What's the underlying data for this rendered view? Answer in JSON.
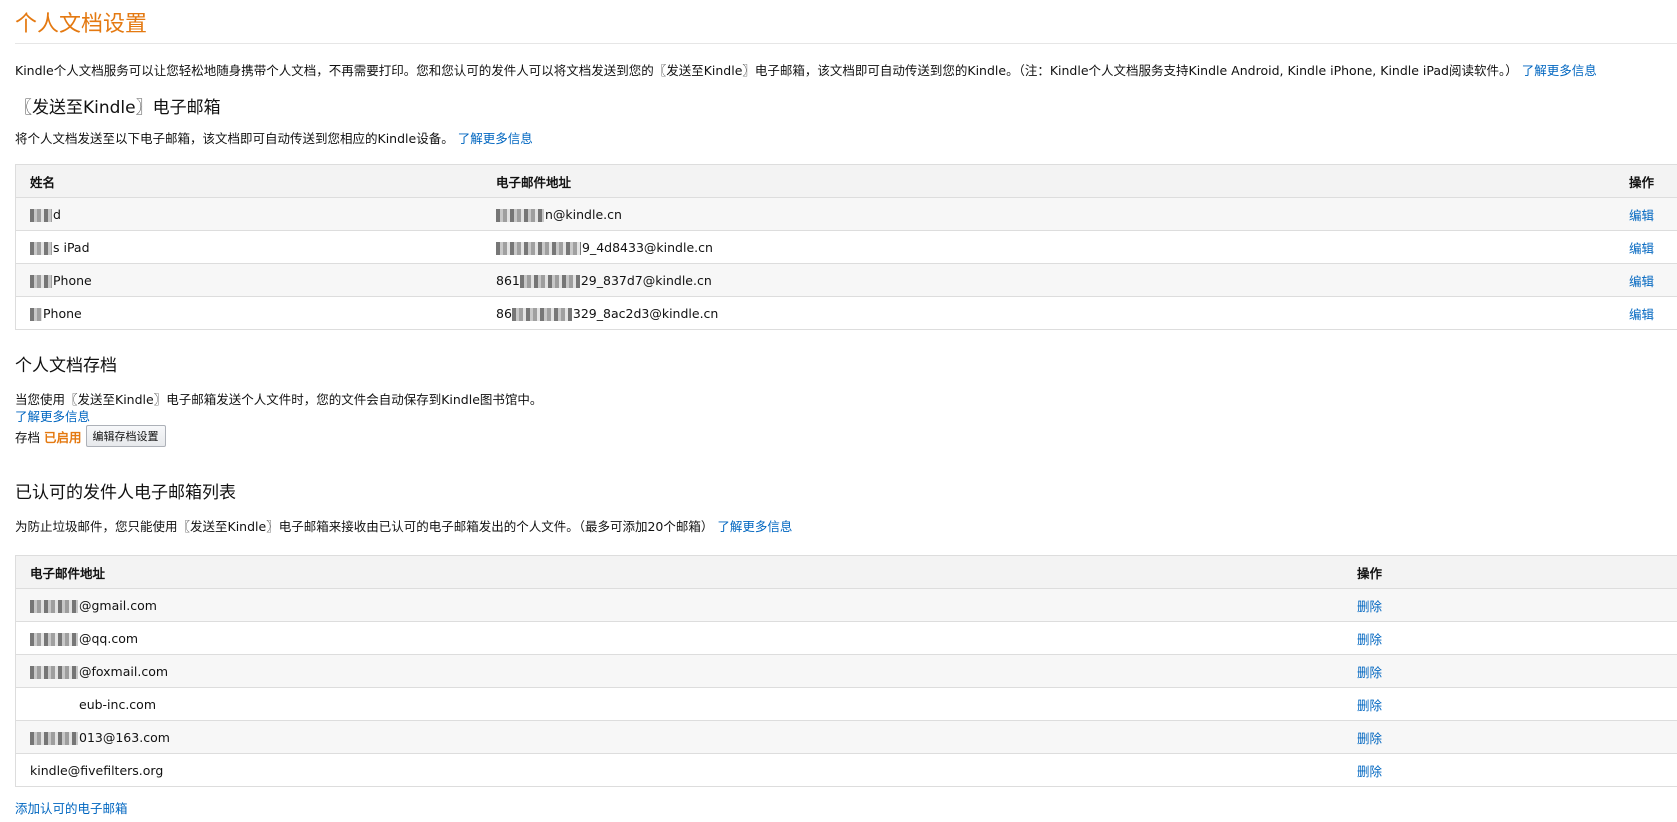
{
  "page": {
    "title": "个人文档设置",
    "intro_text": "Kindle个人文档服务可以让您轻松地随身携带个人文档，不再需要打印。您和您认可的发件人可以将文档发送到您的〖发送至Kindle〗电子邮箱，该文档即可自动传送到您的Kindle。（注：Kindle个人文档服务支持Kindle Android, Kindle iPhone, Kindle iPad阅读软件。）",
    "learn_more": "了解更多信息"
  },
  "send_to_kindle": {
    "heading": "〖发送至Kindle〗电子邮箱",
    "description": "将个人文档发送至以下电子邮箱，该文档即可自动传送到您相应的Kindle设备。",
    "learn_more": "了解更多信息",
    "columns": {
      "name": "姓名",
      "email": "电子邮件地址",
      "action": "操作"
    },
    "rows": [
      {
        "name": "d",
        "email": "n@kindle.cn",
        "action": "编辑"
      },
      {
        "name": "s iPad",
        "email": "9_4d8433@kindle.cn",
        "action": "编辑"
      },
      {
        "name": "Phone",
        "email_prefix": "861",
        "email": "29_837d7@kindle.cn",
        "action": "编辑"
      },
      {
        "name": "Phone",
        "email_prefix": "86",
        "email": "329_8ac2d3@kindle.cn",
        "action": "编辑"
      }
    ]
  },
  "archive": {
    "heading": "个人文档存档",
    "description": "当您使用〖发送至Kindle〗电子邮箱发送个人文件时，您的文件会自动保存到Kindle图书馆中。",
    "learn_more": "了解更多信息",
    "label": "存档",
    "status": "已启用",
    "edit_button": "编辑存档设置"
  },
  "approved": {
    "heading": "已认可的发件人电子邮箱列表",
    "description": "为防止垃圾邮件，您只能使用〖发送至Kindle〗电子邮箱来接收由已认可的电子邮箱发出的个人文件。（最多可添加20个邮箱）",
    "learn_more": "了解更多信息",
    "columns": {
      "email": "电子邮件地址",
      "action": "操作"
    },
    "rows": [
      {
        "email": "@gmail.com",
        "action": "删除"
      },
      {
        "email": "@qq.com",
        "action": "删除"
      },
      {
        "email": "@foxmail.com",
        "action": "删除"
      },
      {
        "email": "eub-inc.com",
        "action": "删除"
      },
      {
        "email": "013@163.com",
        "action": "删除"
      },
      {
        "email": "kindle@fivefilters.org",
        "action": "删除"
      }
    ],
    "add_link": "添加认可的电子邮箱"
  },
  "colors": {
    "title": "#e47911",
    "link": "#0066c0",
    "status": "#e47911"
  }
}
